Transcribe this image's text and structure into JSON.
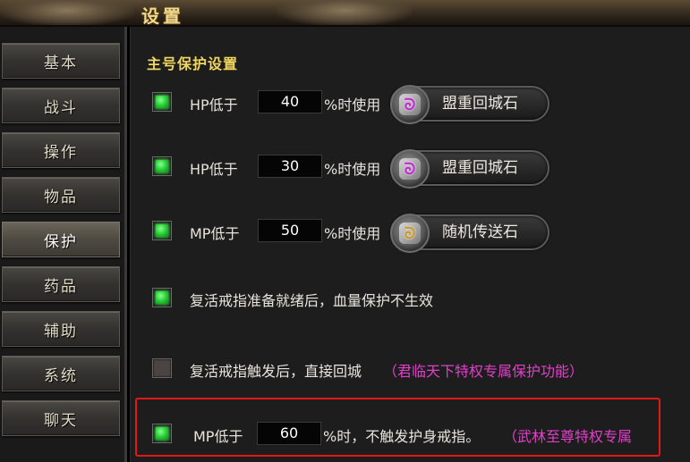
{
  "window": {
    "title": "设置"
  },
  "sidebar": {
    "items": [
      {
        "label": "基本",
        "active": false
      },
      {
        "label": "战斗",
        "active": false
      },
      {
        "label": "操作",
        "active": false
      },
      {
        "label": "物品",
        "active": false
      },
      {
        "label": "保护",
        "active": true
      },
      {
        "label": "药品",
        "active": false
      },
      {
        "label": "辅助",
        "active": false
      },
      {
        "label": "系统",
        "active": false
      },
      {
        "label": "聊天",
        "active": false
      }
    ]
  },
  "panel": {
    "section_title": "主号保护设置",
    "rows": [
      {
        "checked": true,
        "stat": "HP低于",
        "value": "40",
        "suffix": "%时使用",
        "item_label": "盟重回城石",
        "item_icon": "return-stone-icon"
      },
      {
        "checked": true,
        "stat": "HP低于",
        "value": "30",
        "suffix": "%时使用",
        "item_label": "盟重回城石",
        "item_icon": "return-stone-icon"
      },
      {
        "checked": true,
        "stat": "MP低于",
        "value": "50",
        "suffix": "%时使用",
        "item_label": "随机传送石",
        "item_icon": "random-teleport-stone-icon"
      }
    ],
    "revive_ready": {
      "checked": true,
      "label": "复活戒指准备就绪后，血量保护不生效"
    },
    "revive_trigger": {
      "checked": false,
      "label": "复活戒指触发后，直接回城",
      "note": "（君临天下特权专属保护功能）"
    },
    "mp_ring": {
      "checked": true,
      "stat": "MP低于",
      "value": "60",
      "suffix": "%时，不触发护身戒指。",
      "note": "（武林至尊特权专属"
    }
  },
  "colors": {
    "accent_title": "#f0d860",
    "privilege_note": "#e040c8",
    "highlight_border": "#e01818",
    "checkbox_on": "#22c832"
  }
}
